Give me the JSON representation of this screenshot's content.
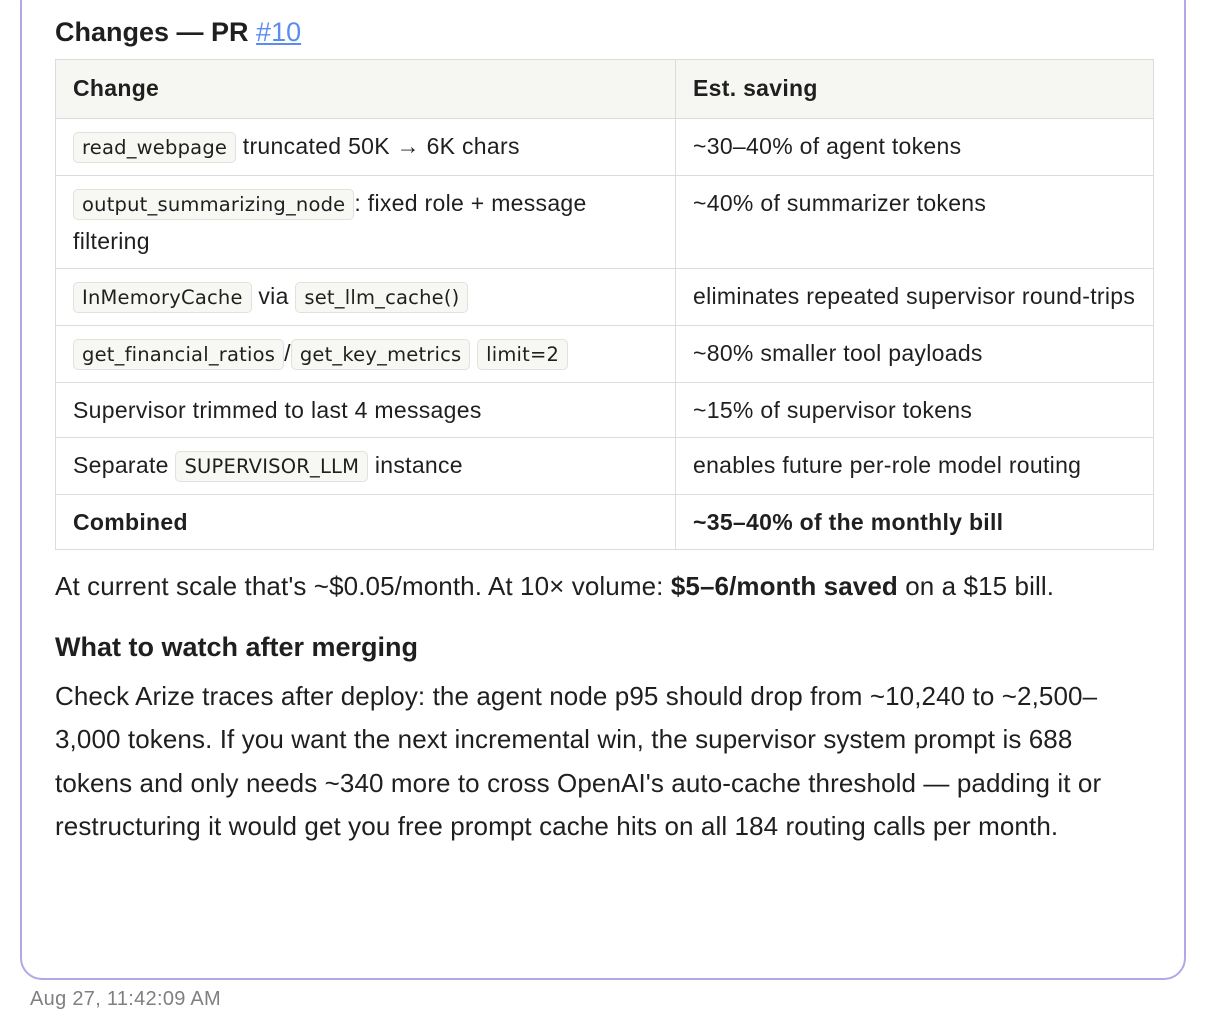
{
  "section_title": "Changes — PR ",
  "pr_link": "#10",
  "table": {
    "headers": [
      "Change",
      "Est. saving"
    ],
    "rows": [
      {
        "change": [
          {
            "type": "code",
            "text": "read_webpage"
          },
          {
            "type": "text",
            "text": " truncated 50K → 6K chars"
          }
        ],
        "saving": "~30–40% of agent tokens"
      },
      {
        "change": [
          {
            "type": "code",
            "text": "output_summarizing_node"
          },
          {
            "type": "text",
            "text": ": fixed role + message filtering"
          }
        ],
        "saving": "~40% of summarizer tokens"
      },
      {
        "change": [
          {
            "type": "code",
            "text": "InMemoryCache"
          },
          {
            "type": "text",
            "text": " via "
          },
          {
            "type": "code",
            "text": "set_llm_cache()"
          }
        ],
        "saving": "eliminates repeated supervisor round-trips"
      },
      {
        "change": [
          {
            "type": "code",
            "text": "get_financial_ratios"
          },
          {
            "type": "text",
            "text": "/"
          },
          {
            "type": "code",
            "text": "get_key_metrics"
          },
          {
            "type": "text",
            "text": " "
          },
          {
            "type": "code",
            "text": "limit=2"
          }
        ],
        "saving": "~80% smaller tool payloads"
      },
      {
        "change": [
          {
            "type": "text",
            "text": "Supervisor trimmed to last 4 messages"
          }
        ],
        "saving": "~15% of supervisor tokens"
      },
      {
        "change": [
          {
            "type": "text",
            "text": "Separate "
          },
          {
            "type": "code",
            "text": "SUPERVISOR_LLM"
          },
          {
            "type": "text",
            "text": " instance"
          }
        ],
        "saving": "enables future per-role model routing"
      }
    ],
    "total": {
      "change": "Combined",
      "saving": "~35–40% of the monthly bill"
    }
  },
  "scale_paragraph": {
    "before": "At current scale that's ~$0.05/month. At 10× volume: ",
    "bold": "$5–6/month saved",
    "after": " on a $15 bill."
  },
  "watch_heading": "What to watch after merging",
  "watch_paragraph": "Check Arize traces after deploy: the agent node p95 should drop from ~10,240 to ~2,500–3,000 tokens. If you want the next incremental win, the supervisor system prompt is 688 tokens and only needs ~340 more to cross OpenAI's auto-cache threshold — padding it or restructuring it would get you free prompt cache hits on all 184 routing calls per month.",
  "timestamp": "Aug 27, 11:42:09 AM",
  "colors": {
    "bubble_border": "#b7a6e6",
    "link": "#5b8def",
    "header_bg": "#f6f6f3",
    "timestamp": "#808080"
  }
}
